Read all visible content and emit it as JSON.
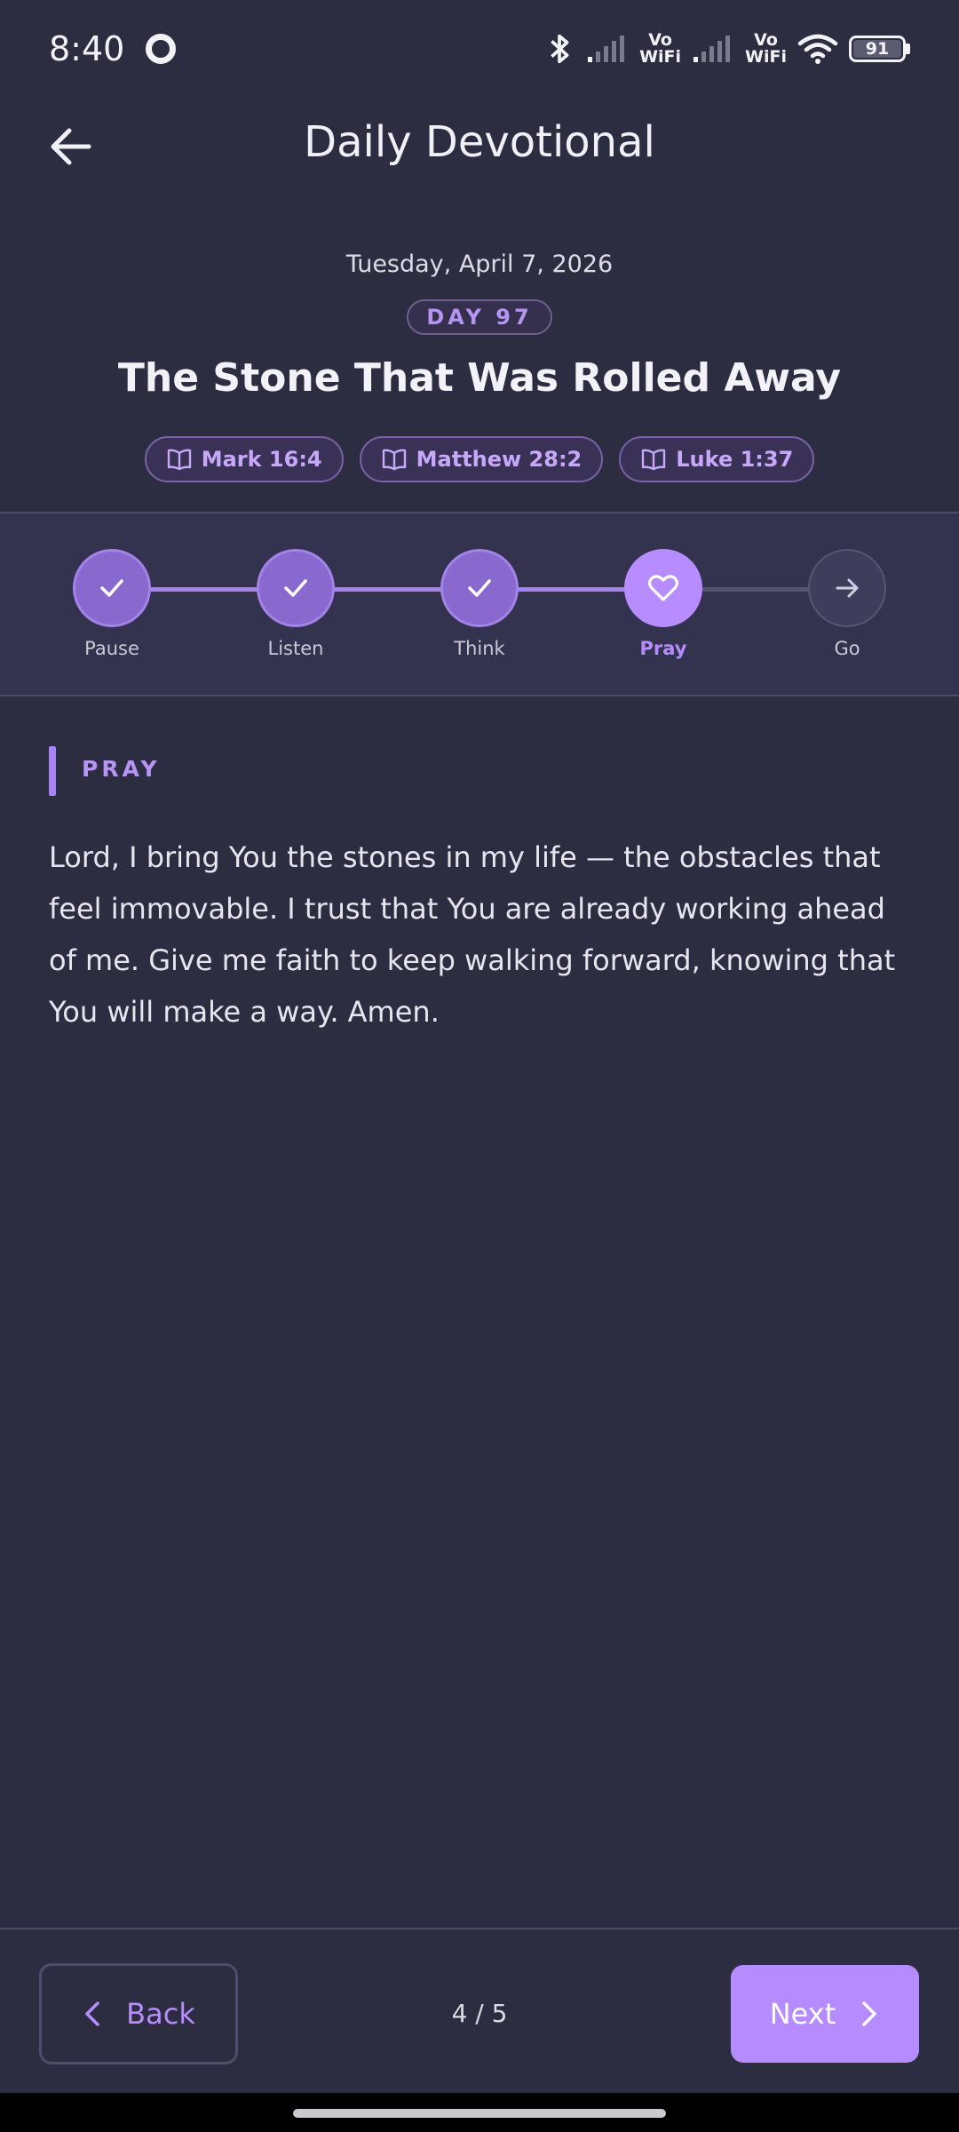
{
  "status_bar": {
    "time": "8:40",
    "network_1": "Vo\nWiFi",
    "network_2": "Vo\nWiFi",
    "battery": "91",
    "icons": [
      "ring-icon",
      "bluetooth-icon",
      "signal-icon",
      "wifi-icon",
      "battery-icon"
    ]
  },
  "header": {
    "title": "Daily Devotional",
    "back_icon": "back-arrow-icon"
  },
  "devotional": {
    "date": "Tuesday, April 7, 2026",
    "day": "DAY 97",
    "title": "The Stone That Was Rolled Away",
    "references": [
      {
        "label": "Mark 16:4",
        "icon": "book-icon"
      },
      {
        "label": "Matthew 28:2",
        "icon": "book-icon"
      },
      {
        "label": "Luke 1:37",
        "icon": "book-icon"
      }
    ]
  },
  "stepper": {
    "steps": [
      {
        "label": "Pause",
        "state": "done",
        "icon": "check-icon"
      },
      {
        "label": "Listen",
        "state": "done",
        "icon": "check-icon"
      },
      {
        "label": "Think",
        "state": "done",
        "icon": "check-icon"
      },
      {
        "label": "Pray",
        "state": "active",
        "icon": "heart-icon"
      },
      {
        "label": "Go",
        "state": "todo",
        "icon": "arrow-right-icon"
      }
    ],
    "current_step": 4,
    "total_steps": 5
  },
  "content": {
    "section": "PRAY",
    "text": "Lord, I bring You the stones in my life — the obstacles that feel immovable. I trust that You are already working ahead of me. Give me faith to keep walking forward, knowing that You will make a way. Amen."
  },
  "footer": {
    "back_label": "Back",
    "next_label": "Next",
    "pager": "4 / 5"
  },
  "colors": {
    "background": "#2d2d42",
    "accent": "#b68bff",
    "done_step": "#8a69cf"
  }
}
